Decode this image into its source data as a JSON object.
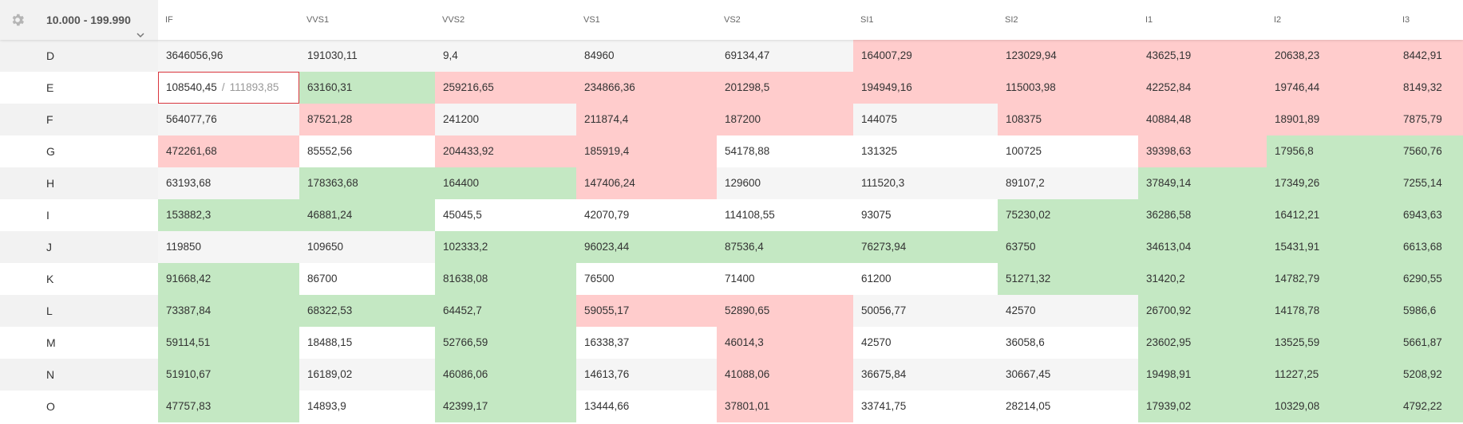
{
  "toolbar": {
    "settings_icon": "gear-icon",
    "range_label": "10.000 - 199.990"
  },
  "colors": {
    "red": "#ffcccc",
    "green": "#c4e8c3",
    "white": "#ffffff",
    "grey": "#f5f5f5",
    "label_even": "#f2f2f2",
    "label_odd": "#ffffff",
    "highlight_border": "#d9363e"
  },
  "columns": [
    "IF",
    "VVS1",
    "VVS2",
    "VS1",
    "VS2",
    "SI1",
    "SI2",
    "I1",
    "I2",
    "I3"
  ],
  "rows": [
    {
      "label": "D",
      "values": [
        "3646056,96",
        "191030,11",
        "9,4",
        "84960",
        "69134,47",
        "164007,29",
        "123029,94",
        "43625,19",
        "20638,23",
        "8442,91"
      ],
      "colors": [
        "n",
        "n",
        "n",
        "n",
        "n",
        "r",
        "r",
        "r",
        "r",
        "r"
      ]
    },
    {
      "label": "E",
      "values": [
        "108540,45",
        "63160,31",
        "259216,65",
        "234866,36",
        "201298,5",
        "194949,16",
        "115003,98",
        "42252,84",
        "19746,44",
        "8149,32"
      ],
      "colors": [
        "n",
        "g",
        "r",
        "r",
        "r",
        "r",
        "r",
        "r",
        "r",
        "r"
      ],
      "compare": {
        "col": 0,
        "sep": "/",
        "value": "111893,85"
      }
    },
    {
      "label": "F",
      "values": [
        "564077,76",
        "87521,28",
        "241200",
        "211874,4",
        "187200",
        "144075",
        "108375",
        "40884,48",
        "18901,89",
        "7875,79"
      ],
      "colors": [
        "n",
        "r",
        "n",
        "r",
        "r",
        "n",
        "r",
        "r",
        "r",
        "r"
      ]
    },
    {
      "label": "G",
      "values": [
        "472261,68",
        "85552,56",
        "204433,92",
        "185919,4",
        "54178,88",
        "131325",
        "100725",
        "39398,63",
        "17956,8",
        "7560,76"
      ],
      "colors": [
        "r",
        "n",
        "r",
        "r",
        "n",
        "n",
        "n",
        "r",
        "g",
        "g"
      ]
    },
    {
      "label": "H",
      "values": [
        "63193,68",
        "178363,68",
        "164400",
        "147406,24",
        "129600",
        "111520,3",
        "89107,2",
        "37849,14",
        "17349,26",
        "7255,14"
      ],
      "colors": [
        "n",
        "g",
        "g",
        "r",
        "n",
        "n",
        "n",
        "g",
        "g",
        "g"
      ]
    },
    {
      "label": "I",
      "values": [
        "153882,3",
        "46881,24",
        "45045,5",
        "42070,79",
        "114108,55",
        "93075",
        "75230,02",
        "36286,58",
        "16412,21",
        "6943,63"
      ],
      "colors": [
        "g",
        "g",
        "n",
        "n",
        "n",
        "n",
        "g",
        "g",
        "g",
        "g"
      ]
    },
    {
      "label": "J",
      "values": [
        "119850",
        "109650",
        "102333,2",
        "96023,44",
        "87536,4",
        "76273,94",
        "63750",
        "34613,04",
        "15431,91",
        "6613,68"
      ],
      "colors": [
        "n",
        "n",
        "g",
        "g",
        "g",
        "g",
        "g",
        "g",
        "g",
        "g"
      ]
    },
    {
      "label": "K",
      "values": [
        "91668,42",
        "86700",
        "81638,08",
        "76500",
        "71400",
        "61200",
        "51271,32",
        "31420,2",
        "14782,79",
        "6290,55"
      ],
      "colors": [
        "g",
        "n",
        "g",
        "n",
        "n",
        "n",
        "g",
        "g",
        "g",
        "g"
      ]
    },
    {
      "label": "L",
      "values": [
        "73387,84",
        "68322,53",
        "64452,7",
        "59055,17",
        "52890,65",
        "50056,77",
        "42570",
        "26700,92",
        "14178,78",
        "5986,6"
      ],
      "colors": [
        "g",
        "g",
        "g",
        "r",
        "r",
        "n",
        "n",
        "g",
        "g",
        "g"
      ]
    },
    {
      "label": "M",
      "values": [
        "59114,51",
        "18488,15",
        "52766,59",
        "16338,37",
        "46014,3",
        "42570",
        "36058,6",
        "23602,95",
        "13525,59",
        "5661,87"
      ],
      "colors": [
        "g",
        "n",
        "g",
        "n",
        "r",
        "n",
        "n",
        "g",
        "g",
        "g"
      ]
    },
    {
      "label": "N",
      "values": [
        "51910,67",
        "16189,02",
        "46086,06",
        "14613,76",
        "41088,06",
        "36675,84",
        "30667,45",
        "19498,91",
        "11227,25",
        "5208,92"
      ],
      "colors": [
        "g",
        "n",
        "g",
        "n",
        "r",
        "n",
        "n",
        "g",
        "g",
        "g"
      ]
    },
    {
      "label": "O",
      "values": [
        "47757,83",
        "14893,9",
        "42399,17",
        "13444,66",
        "37801,01",
        "33741,75",
        "28214,05",
        "17939,02",
        "10329,08",
        "4792,22"
      ],
      "colors": [
        "g",
        "n",
        "g",
        "n",
        "r",
        "n",
        "n",
        "g",
        "g",
        "g"
      ]
    }
  ]
}
